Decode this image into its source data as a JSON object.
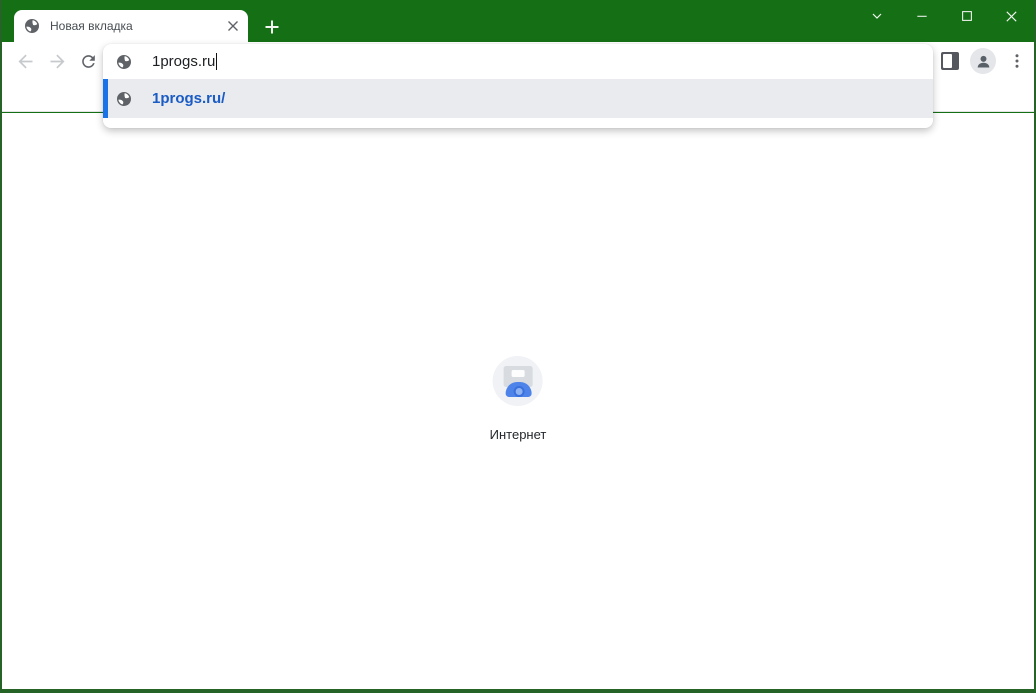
{
  "tab_bar": {
    "tab": {
      "title": "Новая вкладка"
    }
  },
  "window_controls": {
    "buttons": [
      "chevron-down",
      "minimize",
      "maximize",
      "close"
    ]
  },
  "toolbar": {
    "buttons": [
      "back",
      "forward",
      "reload",
      "side-panel",
      "profile",
      "menu"
    ]
  },
  "omnibox": {
    "value": "1progs.ru"
  },
  "suggestions": [
    {
      "text": "1progs.ru/"
    }
  ],
  "content": {
    "app_label": "Интернет"
  },
  "colors": {
    "frame_green": "#157015",
    "frame_border_green": "#266326",
    "accent_blue": "#1a73e8",
    "suggestion_text_blue": "#1a5bc4",
    "suggestion_selected_bg": "#e9ebee"
  }
}
